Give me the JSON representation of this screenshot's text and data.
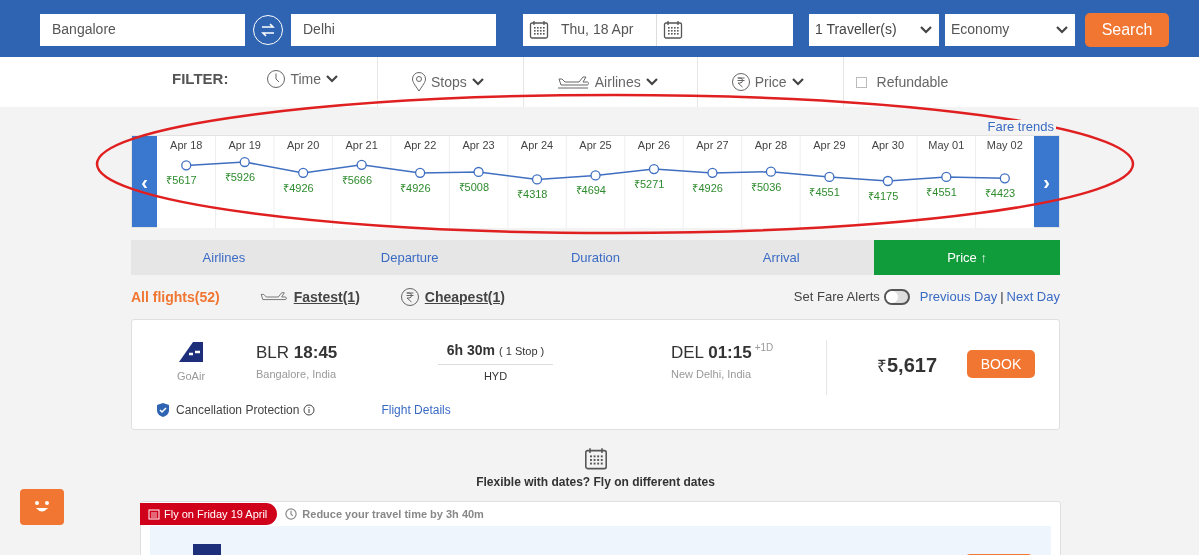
{
  "search": {
    "from": "Bangalore",
    "to": "Delhi",
    "depart_date": "Thu, 18 Apr",
    "travellers": "1 Traveller(s)",
    "cabin": "Economy",
    "button": "Search"
  },
  "filter": {
    "label": "FILTER:",
    "items": [
      {
        "kind": "clock",
        "label": "Time"
      },
      {
        "kind": "pin",
        "label": "Stops"
      },
      {
        "kind": "plane",
        "label": "Airlines"
      },
      {
        "kind": "rupee",
        "label": "Price"
      }
    ],
    "refundable": {
      "label": "Refundable",
      "checked": false
    }
  },
  "fare_trends": {
    "link": "Fare trends",
    "currency": "₹",
    "prev": "‹",
    "next": "›",
    "chart_data": {
      "type": "line",
      "categories": [
        "Apr 18",
        "Apr 19",
        "Apr 20",
        "Apr 21",
        "Apr 22",
        "Apr 23",
        "Apr 24",
        "Apr 25",
        "Apr 26",
        "Apr 27",
        "Apr 28",
        "Apr 29",
        "Apr 30",
        "May 01",
        "May 02"
      ],
      "data_labels": true,
      "series": [
        {
          "color": "#3f6fc0",
          "marker": true,
          "values": [
            5617,
            5926,
            4926,
            5666,
            4926,
            5008,
            4318,
            4694,
            5271,
            4926,
            5036,
            4551,
            4175,
            4551,
            4423
          ]
        }
      ]
    }
  },
  "sort_tabs": [
    {
      "label": "Airlines",
      "selected": false
    },
    {
      "label": "Departure",
      "selected": false
    },
    {
      "label": "Duration",
      "selected": false
    },
    {
      "label": "Arrival",
      "selected": false
    },
    {
      "label": "Price",
      "selected": true,
      "arrow": "↑"
    }
  ],
  "quick_filters": {
    "all": "All flights(52)",
    "fastest": "Fastest(1)",
    "cheapest": "Cheapest(1)",
    "fare_alerts": {
      "label": "Set Fare Alerts",
      "on": false
    },
    "previous_day": "Previous Day",
    "separator": "|",
    "next_day": "Next Day"
  },
  "flights": [
    {
      "airline": "GoAir",
      "from_code": "BLR",
      "depart": "18:45",
      "from_city": "Bangalore, India",
      "duration": "6h 30m",
      "stops": "( 1 Stop )",
      "via": "HYD",
      "to_code": "DEL",
      "arrive": "01:15",
      "day_offset": "+1D",
      "to_city": "New Delhi, India",
      "price": "5,617",
      "currency": "₹",
      "book": "BOOK",
      "protection": "Cancellation Protection",
      "details": "Flight Details"
    }
  ],
  "flexible": {
    "title": "Flexible with dates? Fly on different dates",
    "badge": "Fly on Friday 19 April",
    "note": "Reduce your travel time by 3h 40m"
  }
}
